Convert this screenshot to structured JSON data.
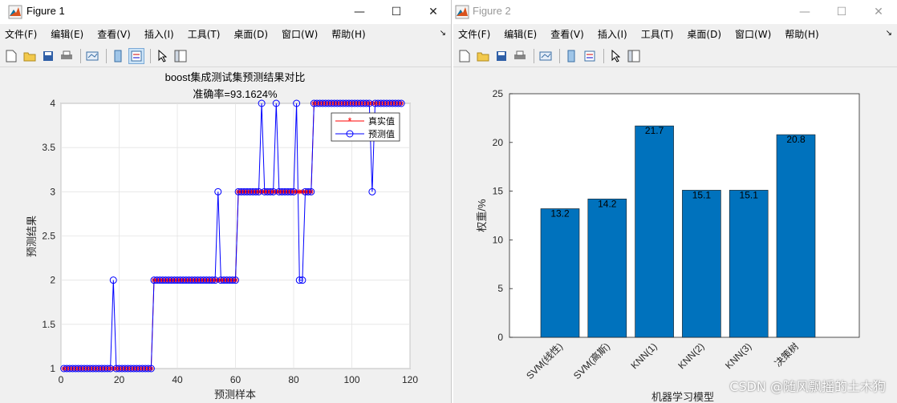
{
  "windows": [
    {
      "title": "Figure 1",
      "menu": [
        "文件(F)",
        "编辑(E)",
        "查看(V)",
        "插入(I)",
        "工具(T)",
        "桌面(D)",
        "窗口(W)",
        "帮助(H)"
      ],
      "toolbar_icons": [
        "new-figure-icon",
        "open-file-icon",
        "save-icon",
        "print-icon",
        "link-plot-icon",
        "colorbar-icon",
        "legend-icon",
        "edit-plot-icon",
        "property-inspector-icon"
      ]
    },
    {
      "title": "Figure 2",
      "menu": [
        "文件(F)",
        "编辑(E)",
        "查看(V)",
        "插入(I)",
        "工具(T)",
        "桌面(D)",
        "窗口(W)",
        "帮助(H)"
      ],
      "toolbar_icons": [
        "new-figure-icon",
        "open-file-icon",
        "save-icon",
        "print-icon",
        "link-plot-icon",
        "colorbar-icon",
        "legend-icon",
        "edit-plot-icon",
        "property-inspector-icon"
      ]
    }
  ],
  "window_controls": {
    "minimize": "—",
    "maximize": "☐",
    "close": "✕"
  },
  "menu_overflow": "↘",
  "watermark": "CSDN @随风飘摇的土木狗",
  "chart_data": [
    {
      "type": "line",
      "title": "boost集成测试集预测结果对比",
      "subtitle": "准确率=93.1624%",
      "xlabel": "预测样本",
      "ylabel": "预测结果",
      "xlim": [
        0,
        120
      ],
      "ylim": [
        1,
        4
      ],
      "xticks": [
        0,
        20,
        40,
        60,
        80,
        100,
        120
      ],
      "yticks": [
        1,
        1.5,
        2,
        2.5,
        3,
        3.5,
        4
      ],
      "grid": true,
      "legend": "top-right",
      "series": [
        {
          "name": "真实值",
          "color": "#ff0000",
          "marker": "*",
          "values": [
            1,
            1,
            1,
            1,
            1,
            1,
            1,
            1,
            1,
            1,
            1,
            1,
            1,
            1,
            1,
            1,
            1,
            1,
            1,
            1,
            1,
            1,
            1,
            1,
            1,
            1,
            1,
            1,
            1,
            1,
            1,
            2,
            2,
            2,
            2,
            2,
            2,
            2,
            2,
            2,
            2,
            2,
            2,
            2,
            2,
            2,
            2,
            2,
            2,
            2,
            2,
            2,
            2,
            2,
            2,
            2,
            2,
            2,
            2,
            2,
            3,
            3,
            3,
            3,
            3,
            3,
            3,
            3,
            3,
            3,
            3,
            3,
            3,
            3,
            3,
            3,
            3,
            3,
            3,
            3,
            3,
            3,
            3,
            3,
            3,
            3,
            4,
            4,
            4,
            4,
            4,
            4,
            4,
            4,
            4,
            4,
            4,
            4,
            4,
            4,
            4,
            4,
            4,
            4,
            4,
            4,
            4,
            4,
            4,
            4,
            4,
            4,
            4,
            4,
            4,
            4,
            4
          ]
        },
        {
          "name": "预测值",
          "color": "#0000ff",
          "marker": "o",
          "values": [
            1,
            1,
            1,
            1,
            1,
            1,
            1,
            1,
            1,
            1,
            1,
            1,
            1,
            1,
            1,
            1,
            1,
            2,
            1,
            1,
            1,
            1,
            1,
            1,
            1,
            1,
            1,
            1,
            1,
            1,
            1,
            2,
            2,
            2,
            2,
            2,
            2,
            2,
            2,
            2,
            2,
            2,
            2,
            2,
            2,
            2,
            2,
            2,
            2,
            2,
            2,
            2,
            2,
            3,
            2,
            2,
            2,
            2,
            2,
            2,
            3,
            3,
            3,
            3,
            3,
            3,
            3,
            3,
            4,
            3,
            3,
            3,
            3,
            4,
            3,
            3,
            3,
            3,
            3,
            3,
            4,
            2,
            2,
            3,
            3,
            3,
            4,
            4,
            4,
            4,
            4,
            4,
            4,
            4,
            4,
            4,
            4,
            4,
            4,
            4,
            4,
            4,
            4,
            4,
            4,
            4,
            3,
            4,
            4,
            4,
            4,
            4,
            4,
            4,
            4,
            4,
            4
          ]
        }
      ]
    },
    {
      "type": "bar",
      "xlabel": "机器学习模型",
      "ylabel": "权重/%",
      "ylim": [
        0,
        25
      ],
      "yticks": [
        0,
        5,
        10,
        15,
        20,
        25
      ],
      "categories": [
        "SVM(线性)",
        "SVM(高斯)",
        "KNN(1)",
        "KNN(2)",
        "KNN(3)",
        "决策树"
      ],
      "values": [
        13.2,
        14.2,
        21.7,
        15.1,
        15.1,
        20.8
      ],
      "labels": [
        "13.2",
        "14.2",
        "21.7",
        "15.1",
        "15.1",
        "20.8"
      ],
      "bar_color": "#0072bd",
      "grid": false
    }
  ]
}
